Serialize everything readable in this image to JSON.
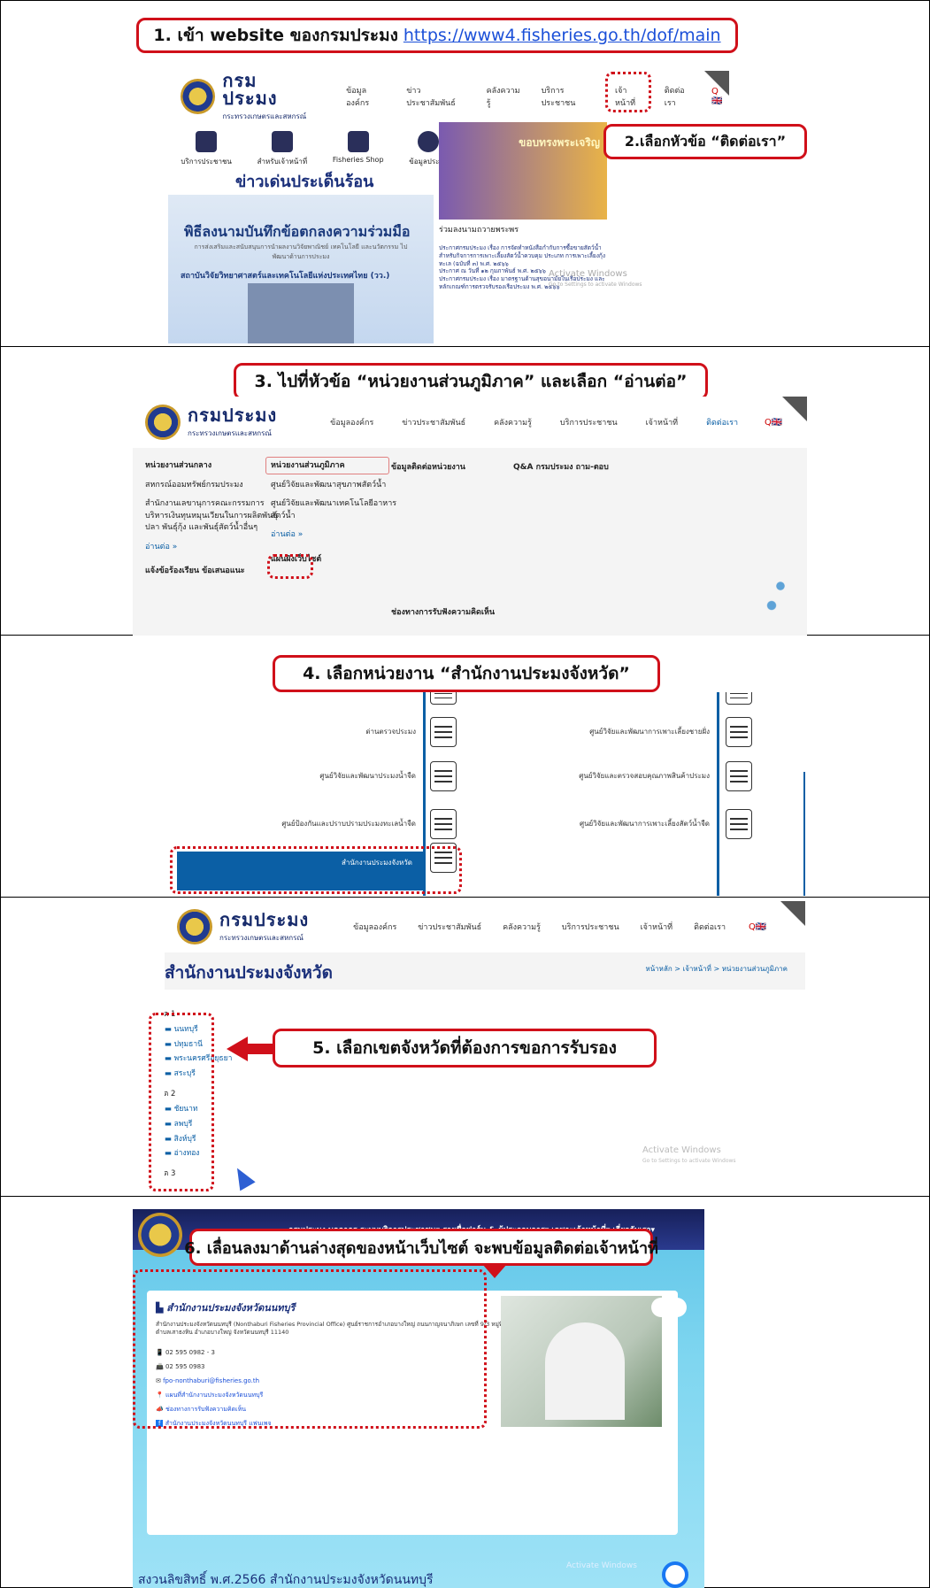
{
  "step1": {
    "label": "1.   เข้า website ของกรมประมง",
    "url": "https://www4.fisheries.go.th/dof/main"
  },
  "step2": {
    "label": "2.เลือกหัวข้อ “ติดต่อเรา”"
  },
  "step3": {
    "label": "3. ไปที่หัวข้อ “หน่วยงานส่วนภูมิภาค” และเลือก “อ่านต่อ”"
  },
  "step4": {
    "label": "4. เลือกหน่วยงาน “สำนักงานประมงจังหวัด”"
  },
  "step5": {
    "label": "5. เลือกเขตจังหวัดที่ต้องการขอการรับรอง"
  },
  "step6": {
    "label": "6. เลื่อนลงมาด้านล่างสุดของหน้าเว็บไซต์ จะพบข้อมูลติดต่อเจ้าหน้าที่"
  },
  "site": {
    "brand": "กรมประมง",
    "brand_sub": "กระทรวงเกษตรและสหกรณ์",
    "nav": [
      "ข้อมูลองค์กร",
      "ข่าวประชาสัมพันธ์",
      "คลังความรู้",
      "บริการประชาชน",
      "เจ้าหน้าที่",
      "ติดต่อเรา"
    ],
    "search": "Q🇬🇧"
  },
  "shot1": {
    "services": [
      "บริการประชาชน",
      "สำหรับเจ้าหน้าที่",
      "Fisheries Shop",
      "ข้อมูลประมง"
    ],
    "headline": "ข่าวเด่นประเด็นร้อน",
    "banner_title": "พิธีลงนามบันทึกข้อตกลงความร่วมมือ",
    "banner_sub": "การส่งเสริมและสนับสนุนการนำผลงานวิจัยพาณิชย์ เทคโนโลยี และนวัตกรรม ไปพัฒนาด้านการประมง",
    "banner_bottom": "สถาบันวิจัยวิทยาศาสตร์และเทคโนโลยีแห่งประเทศไทย (วว.)",
    "royal_caption": "ร่วมลงนามถวายพระพร",
    "royal_banner": "ขอบทรงพระเจริญ",
    "news": [
      "ประกาศกรมประมง เรื่อง การจัดทำหนังสือกำกับการซื้อขายสัตว์น้ำสำหรับกิจการการเพาะเลี้ยงสัตว์น้ำควบคุม ประเภท การเพาะเลี้ยงกุ้งทะเล (ฉบับที่ ๓) พ.ศ. ๒๕๖๖",
      "ประกาศ ณ วันที่ ๑๒ กุมภาพันธ์ พ.ศ. ๒๕๖๖",
      "ประกาศกรมประมง เรื่อง มาตรฐานด้านสุขอนามัยในเรือประมง และหลักเกณฑ์การตรวจรับรองเรือประมง พ.ศ. ๒๕๖๖"
    ],
    "activate": "Activate Windows",
    "activate_sub": "Go to Settings to activate Windows"
  },
  "shot2": {
    "col1": [
      "หน่วยงานส่วนกลาง",
      "สหกรณ์ออมทรัพย์กรมประมง",
      "สำนักงานเลขานุการคณะกรรมการบริหารเงินทุนหมุนเวียนในการผลิตพันธุ์ปลา พันธุ์กุ้ง และพันธุ์สัตว์น้ำอื่นๆ",
      "อ่านต่อ »",
      "แจ้งข้อร้องเรียน ข้อเสนอแนะ"
    ],
    "col2": [
      "หน่วยงานส่วนภูมิภาค",
      "ศูนย์วิจัยและพัฒนาสุขภาพสัตว์น้ำ",
      "ศูนย์วิจัยและพัฒนาเทคโนโลยีอาหารสัตว์น้ำ",
      "อ่านต่อ »",
      "แผนผังเว็บไซต์"
    ],
    "col3": [
      "ข้อมูลติดต่อหน่วยงาน",
      "ช่องทางการรับฟังความคิดเห็น"
    ],
    "col4": [
      "Q&A กรมประมง ถาม-ตอบ"
    ]
  },
  "shot3": {
    "left": [
      "ด่านตรวจประมง",
      "ศูนย์วิจัยและพัฒนาประมงน้ำจืด",
      "ศูนย์ป้องกันและปราบปรามประมงทะเลน้ำจืด",
      "สำนักงานประมงจังหวัด"
    ],
    "right": [
      "ศูนย์วิจัยและพัฒนาการเพาะเลี้ยงชายฝั่ง",
      "ศูนย์วิจัยและตรวจสอบคุณภาพสินค้าประมง",
      "ศูนย์วิจัยและพัฒนาการเพาะเลี้ยงสัตว์น้ำจืด"
    ]
  },
  "shot4": {
    "title": "สำนักงานประมงจังหวัด",
    "breadcrumb": "หน้าหลัก > เจ้าหน้าที่ > หน่วยงานส่วนภูมิภาค",
    "zone1": "เขต 1",
    "zone1_items": [
      "นนทบุรี",
      "ปทุมธานี",
      "พระนครศรีอยุธยา",
      "สระบุรี"
    ],
    "zone2": "เขต 2",
    "zone2_items": [
      "ชัยนาท",
      "ลพบุรี",
      "สิงห์บุรี",
      "อ่างทอง"
    ],
    "zone3": "เขต 3",
    "activate": "Activate Windows",
    "activate_sub": "Go to Settings to activate Windows"
  },
  "shot5": {
    "nav": "กรมประมง   บุคลากร   ระบบบริการประชาชน▾   รายชื่อฟาร์ม & ผู้ประกอบการ▾   เฉพาะเจ้าหน้าที่▾   เกี่ยวกับเรา▾",
    "office": "สำนักงานประมงจังหวัดนนทบุรี",
    "desc": "สำนักงานประมงจังหวัดนนทบุรี (Nonthaburi Fisheries Provincial Office) ศูนย์ราชการอำเภอบางใหญ่ ถนนกาญจนาภิเษก เลขที่ 9/3 หมู่ที่ 5 ตำบลเสาธงหิน อำเภอบางใหญ่ จังหวัดนนทบุรี 11140",
    "phone": "02 595 0982 - 3",
    "fax": "02 595 0983",
    "email": "fpo-nonthaburi@fisheries.go.th",
    "map": "แผนที่สำนักงานประมงจังหวัดนนทบุรี",
    "feedback": "ช่องทางการรับฟังความคิดเห็น",
    "facebook": "สำนักงานประมงจังหวัดนนทบุรี แฟนเพจ",
    "footer": "สงวนลิขสิทธิ์ พ.ศ.2566 สำนักงานประมงจังหวัดนนทบุรี",
    "activate": "Activate Windows"
  },
  "colors": {
    "accent_red": "#d0101a",
    "brand_navy": "#15296a",
    "link_blue": "#1a4fd8",
    "panel_blue": "#0b5fa5"
  }
}
